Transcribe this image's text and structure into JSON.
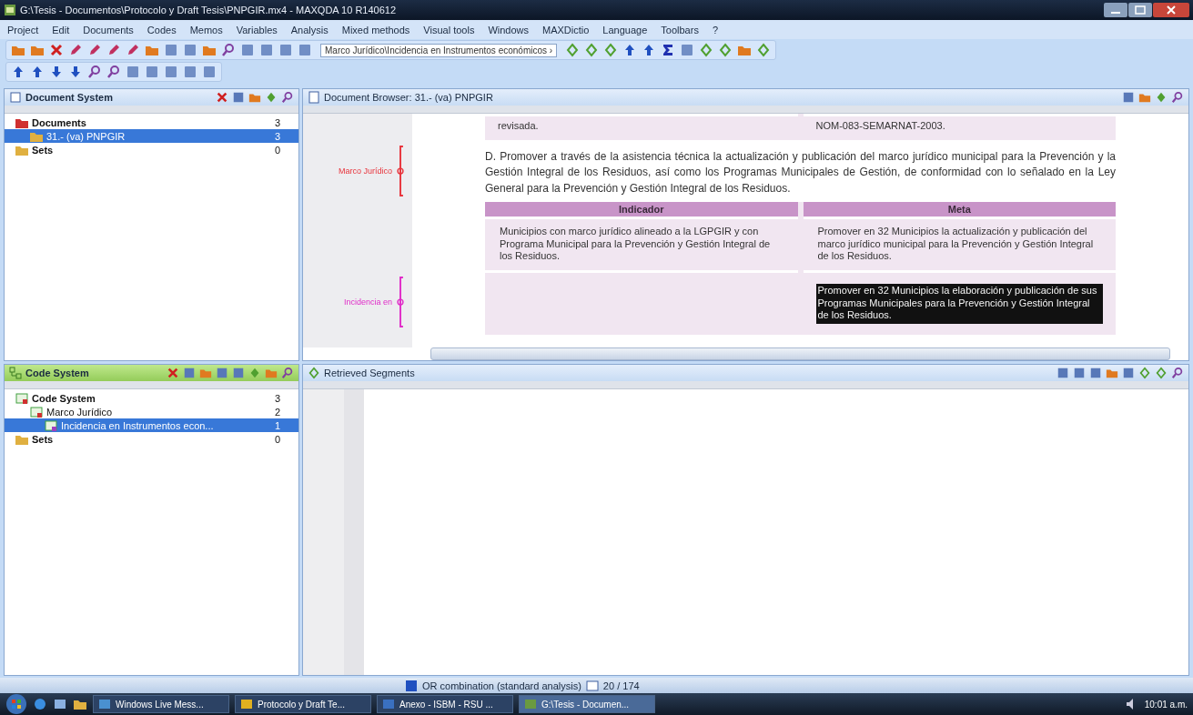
{
  "window": {
    "title": "G:\\Tesis - Documentos\\Protocolo y Draft Tesis\\PNPGIR.mx4 - MAXQDA 10  R140612"
  },
  "menu": [
    "Project",
    "Edit",
    "Documents",
    "Codes",
    "Memos",
    "Variables",
    "Analysis",
    "Mixed methods",
    "Visual tools",
    "Windows",
    "MAXDictio",
    "Language",
    "Toolbars",
    "?"
  ],
  "toolbar": {
    "code_combo": "Marco Jurídico\\Incidencia en Instrumentos económicos ›"
  },
  "document_system": {
    "title": "Document System",
    "tree": [
      {
        "label": "Documents",
        "count": "3",
        "selected": false,
        "children": [
          {
            "label": "31.- (va) PNPGIR",
            "count": "3",
            "selected": true
          }
        ]
      },
      {
        "label": "Sets",
        "count": "0",
        "selected": false
      }
    ]
  },
  "document_browser": {
    "title": "Document Browser: 31.- (va) PNPGIR",
    "top_row": [
      "revisada.",
      "NOM-083-SEMARNAT-2003."
    ],
    "paragraph": "D. Promover a través de la asistencia técnica la actualización y publicación del marco jurídico municipal para la Prevención y la Gestión Integral de los Residuos, así como los Programas Municipales de Gestión, de conformidad con lo señalado en la Ley General para la Prevención y Gestión Integral de los Residuos.",
    "table": {
      "columns": [
        "Indicador",
        "Meta"
      ],
      "rows": [
        [
          {
            "text": "Municipios con marco jurídico alineado a la LGPGIR y con Programa Municipal para la Prevención y Gestión Integral de los Residuos.",
            "selected": false
          },
          {
            "text": "Promover en 32 Municipios la actualización y publicación del marco jurídico municipal para la Prevención y Gestión Integral de los Residuos.",
            "selected": false
          }
        ],
        [
          null,
          {
            "text": "Promover en 32 Municipios la elaboración y publicación de sus Programas Municipales para la Prevención y Gestión Integral de los Residuos.",
            "selected": true
          }
        ]
      ]
    },
    "margin_codes": [
      {
        "label": "Marco Jurídico",
        "color": "#e8343c"
      },
      {
        "label": "Incidencia en",
        "color": "#e02cc8"
      }
    ]
  },
  "code_system": {
    "title": "Code System",
    "tree": [
      {
        "label": "Code System",
        "count": "3",
        "selected": false,
        "children": [
          {
            "label": "Marco Jurídico",
            "count": "2",
            "selected": false,
            "children": [
              {
                "label": "Incidencia en Instrumentos econ...",
                "count": "1",
                "selected": true
              }
            ]
          }
        ]
      },
      {
        "label": "Sets",
        "count": "0",
        "selected": false
      }
    ]
  },
  "retrieved_segments": {
    "title": "Retrieved Segments"
  },
  "status_bar": {
    "analysis": "OR combination (standard analysis)",
    "count": "20 / 174"
  },
  "taskbar": {
    "items": [
      "Windows Live Mess...",
      "Protocolo y Draft Te...",
      "Anexo - ISBM - RSU ...",
      "G:\\Tesis - Documen..."
    ],
    "clock": "10:01 a.m."
  }
}
